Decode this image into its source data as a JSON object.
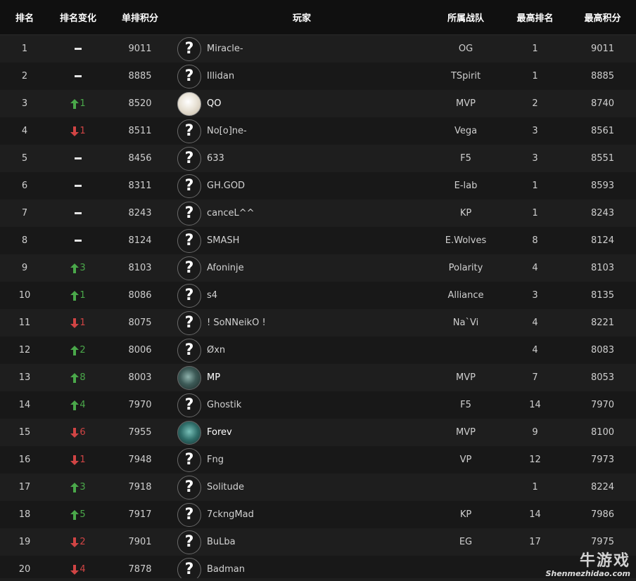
{
  "header": {
    "rank": "排名",
    "change": "排名变化",
    "score": "单排积分",
    "player": "玩家",
    "team": "所属战队",
    "best_rank": "最高排名",
    "best_score": "最高积分"
  },
  "colors": {
    "up": "#4aa84a",
    "down": "#d04444"
  },
  "rows": [
    {
      "rank": "1",
      "change_dir": "none",
      "change": "",
      "score": "9011",
      "avatar": "question-mark-avatar",
      "player": "Miracle-",
      "team": "OG",
      "best_rank": "1",
      "best_score": "9011"
    },
    {
      "rank": "2",
      "change_dir": "none",
      "change": "",
      "score": "8885",
      "avatar": "question-mark-avatar",
      "player": "Illidan",
      "team": "TSpirit",
      "best_rank": "1",
      "best_score": "8885"
    },
    {
      "rank": "3",
      "change_dir": "up",
      "change": "1",
      "score": "8520",
      "avatar": "player-photo-avatar",
      "player": "QO",
      "team": "MVP",
      "best_rank": "2",
      "best_score": "8740"
    },
    {
      "rank": "4",
      "change_dir": "down",
      "change": "1",
      "score": "8511",
      "avatar": "question-mark-avatar",
      "player": "No[o]ne-",
      "team": "Vega",
      "best_rank": "3",
      "best_score": "8561"
    },
    {
      "rank": "5",
      "change_dir": "none",
      "change": "",
      "score": "8456",
      "avatar": "question-mark-avatar",
      "player": "633",
      "team": "F5",
      "best_rank": "3",
      "best_score": "8551"
    },
    {
      "rank": "6",
      "change_dir": "none",
      "change": "",
      "score": "8311",
      "avatar": "question-mark-avatar",
      "player": "GH.GOD",
      "team": "E-lab",
      "best_rank": "1",
      "best_score": "8593"
    },
    {
      "rank": "7",
      "change_dir": "none",
      "change": "",
      "score": "8243",
      "avatar": "question-mark-avatar",
      "player": "canceL^^",
      "team": "KP",
      "best_rank": "1",
      "best_score": "8243"
    },
    {
      "rank": "8",
      "change_dir": "none",
      "change": "",
      "score": "8124",
      "avatar": "question-mark-avatar",
      "player": "SMASH",
      "team": "E.Wolves",
      "best_rank": "8",
      "best_score": "8124"
    },
    {
      "rank": "9",
      "change_dir": "up",
      "change": "3",
      "score": "8103",
      "avatar": "question-mark-avatar",
      "player": "Afoninje",
      "team": "Polarity",
      "best_rank": "4",
      "best_score": "8103"
    },
    {
      "rank": "10",
      "change_dir": "up",
      "change": "1",
      "score": "8086",
      "avatar": "question-mark-avatar",
      "player": "s4",
      "team": "Alliance",
      "best_rank": "3",
      "best_score": "8135"
    },
    {
      "rank": "11",
      "change_dir": "down",
      "change": "1",
      "score": "8075",
      "avatar": "question-mark-avatar",
      "player": "! SoNNeikO !",
      "team": "Na`Vi",
      "best_rank": "4",
      "best_score": "8221"
    },
    {
      "rank": "12",
      "change_dir": "up",
      "change": "2",
      "score": "8006",
      "avatar": "question-mark-avatar",
      "player": "Øxn",
      "team": "",
      "best_rank": "4",
      "best_score": "8083"
    },
    {
      "rank": "13",
      "change_dir": "up",
      "change": "8",
      "score": "8003",
      "avatar": "player-photo-avatar",
      "player": "MP",
      "team": "MVP",
      "best_rank": "7",
      "best_score": "8053"
    },
    {
      "rank": "14",
      "change_dir": "up",
      "change": "4",
      "score": "7970",
      "avatar": "question-mark-avatar",
      "player": "Ghostik",
      "team": "F5",
      "best_rank": "14",
      "best_score": "7970"
    },
    {
      "rank": "15",
      "change_dir": "down",
      "change": "6",
      "score": "7955",
      "avatar": "player-photo-avatar",
      "player": "Forev",
      "team": "MVP",
      "best_rank": "9",
      "best_score": "8100"
    },
    {
      "rank": "16",
      "change_dir": "down",
      "change": "1",
      "score": "7948",
      "avatar": "question-mark-avatar",
      "player": "Fng",
      "team": "VP",
      "best_rank": "12",
      "best_score": "7973"
    },
    {
      "rank": "17",
      "change_dir": "up",
      "change": "3",
      "score": "7918",
      "avatar": "question-mark-avatar",
      "player": "Solitude",
      "team": "",
      "best_rank": "1",
      "best_score": "8224"
    },
    {
      "rank": "18",
      "change_dir": "up",
      "change": "5",
      "score": "7917",
      "avatar": "question-mark-avatar",
      "player": "7ckngMad",
      "team": "KP",
      "best_rank": "14",
      "best_score": "7986"
    },
    {
      "rank": "19",
      "change_dir": "down",
      "change": "2",
      "score": "7901",
      "avatar": "question-mark-avatar",
      "player": "BuLba",
      "team": "EG",
      "best_rank": "17",
      "best_score": "7975"
    },
    {
      "rank": "20",
      "change_dir": "down",
      "change": "4",
      "score": "7878",
      "avatar": "question-mark-avatar",
      "player": "Badman",
      "team": "",
      "best_rank": "",
      "best_score": ""
    }
  ],
  "watermark": {
    "big": "牛游戏",
    "small": "Shenmezhidao.com"
  },
  "avatar_glyph": "?"
}
